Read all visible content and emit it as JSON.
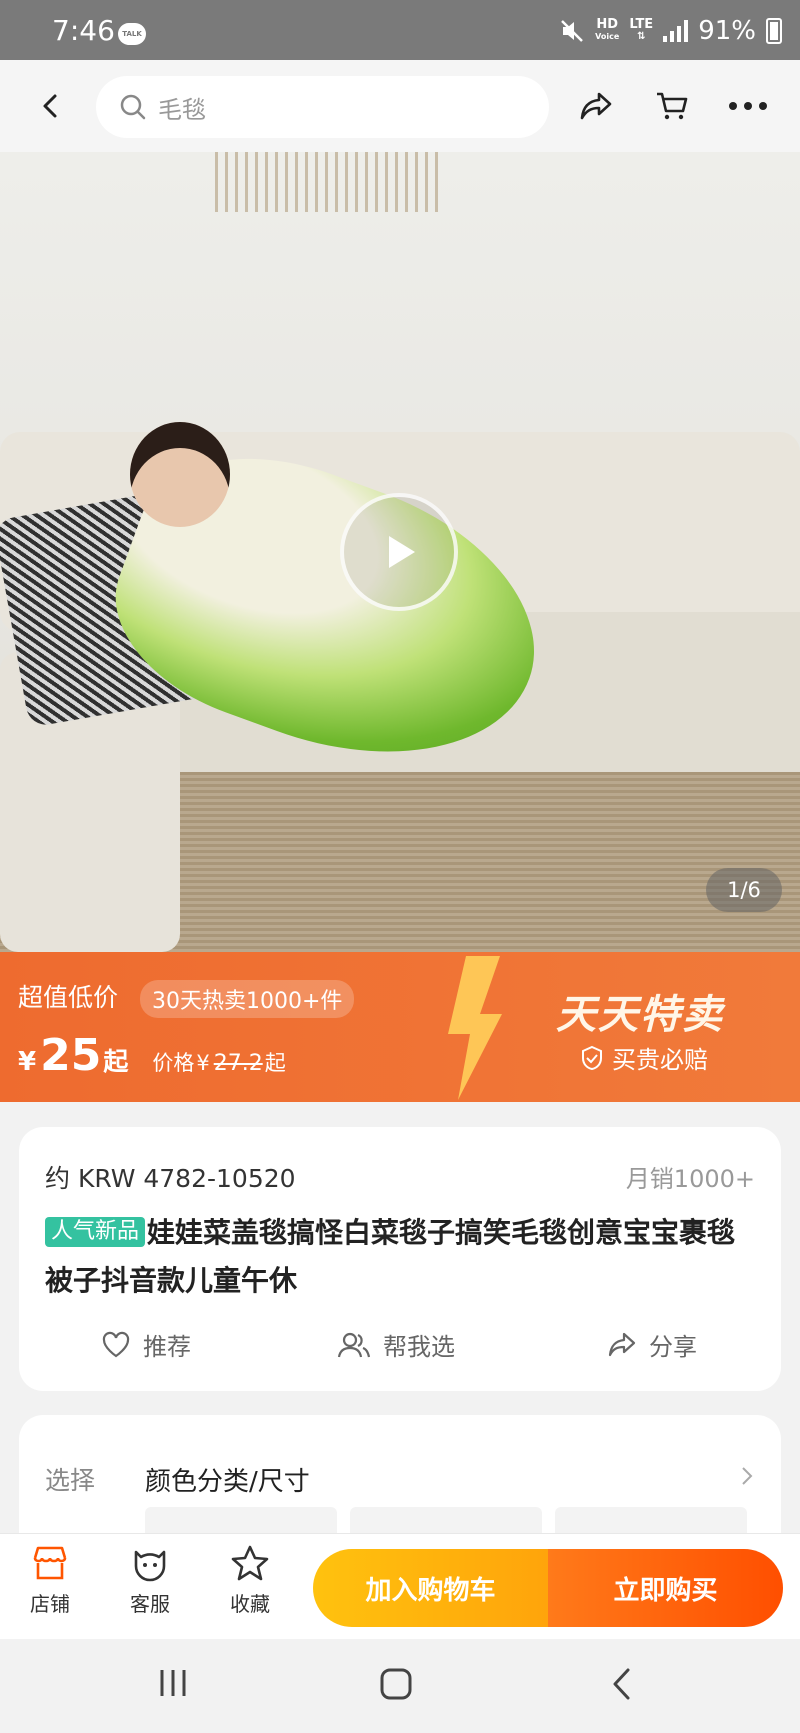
{
  "status_bar": {
    "time": "7:46",
    "talk_badge": "TALK",
    "hd": "HD",
    "voice": "Voice",
    "lte": "LTE",
    "battery": "91%"
  },
  "navbar": {
    "search_text": "毛毯",
    "icons": [
      "back-icon",
      "search-icon",
      "share-icon",
      "cart-icon",
      "more-icon"
    ]
  },
  "gallery": {
    "counter": "1/6",
    "play_icon": "play-icon"
  },
  "promo": {
    "title": "超值低价",
    "pill": "30天热卖1000+件",
    "currency": "¥",
    "price": "25",
    "price_suffix": "起",
    "orig_label": "价格",
    "orig_currency": "¥",
    "orig_price": "27.2",
    "orig_suffix": "起",
    "logo": "天天特卖",
    "guarantee": "买贵必赔"
  },
  "product": {
    "krw": "约 KRW 4782-10520",
    "monthly_sales": "月销1000+",
    "tag": "人气新品",
    "title": "娃娃菜盖毯搞怪白菜毯子搞笑毛毯创意宝宝裹毯被子抖音款儿童午休",
    "actions": [
      "推荐",
      "帮我选",
      "分享"
    ]
  },
  "select": {
    "label": "选择",
    "value": "颜色分类/尺寸"
  },
  "bottom_bar": {
    "tabs": [
      "店铺",
      "客服",
      "收藏"
    ],
    "add_cart": "加入购物车",
    "buy_now": "立即购买"
  },
  "colors": {
    "accent_orange": "#ff5500",
    "promo_orange": "#ef6e33",
    "cart_yellow": "#ffb30f",
    "tag_green": "#34c2a0"
  }
}
